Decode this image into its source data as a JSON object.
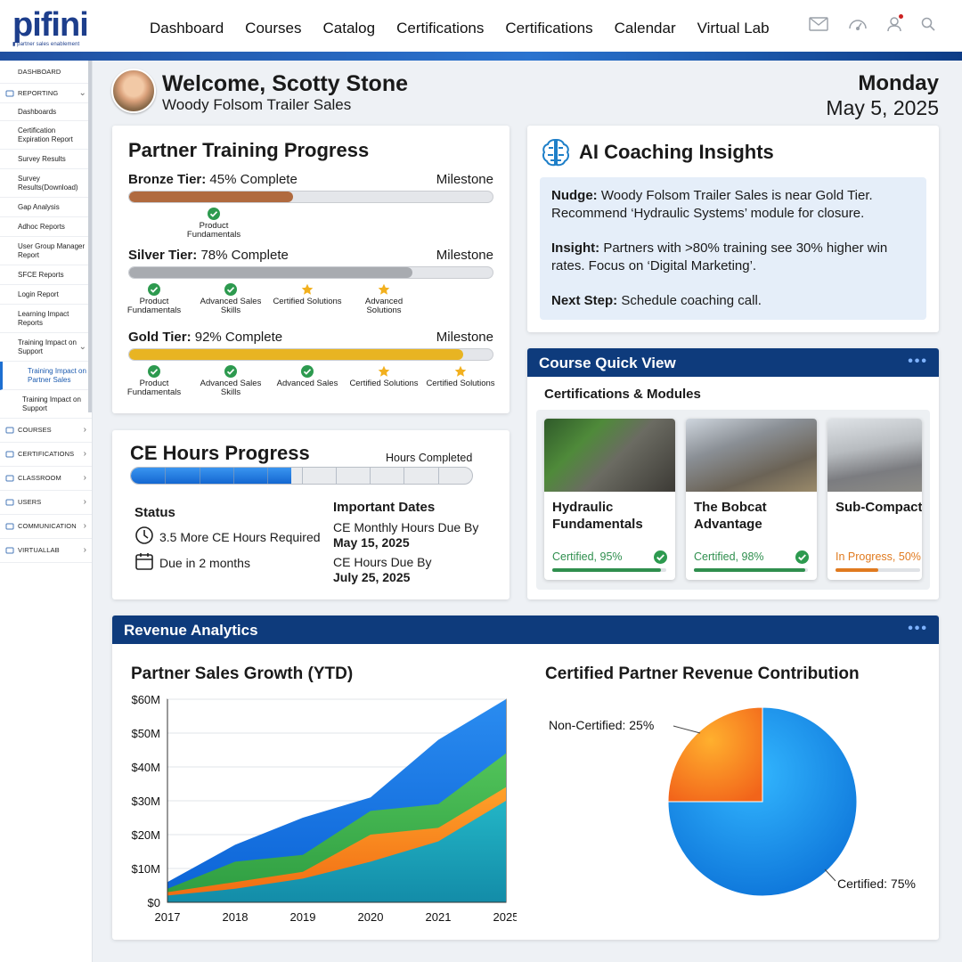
{
  "brand": {
    "name": "pifini",
    "tagline": "partner sales enablement"
  },
  "nav": [
    "Dashboard",
    "Courses",
    "Catalog",
    "Certifications",
    "Certifications",
    "Calendar",
    "Virtual Lab"
  ],
  "sidebar": {
    "items": [
      {
        "label": "DASHBOARD",
        "kind": "top"
      },
      {
        "label": "REPORTING",
        "kind": "head",
        "chev": "⌄"
      },
      {
        "label": "Dashboards",
        "kind": "sub"
      },
      {
        "label": "Certification Expiration Report",
        "kind": "sub"
      },
      {
        "label": "Survey Results",
        "kind": "sub"
      },
      {
        "label": "Survey Results(Download)",
        "kind": "sub"
      },
      {
        "label": "Gap Analysis",
        "kind": "sub"
      },
      {
        "label": "Adhoc Reports",
        "kind": "sub"
      },
      {
        "label": "User Group Manager Report",
        "kind": "sub"
      },
      {
        "label": "SFCE Reports",
        "kind": "sub"
      },
      {
        "label": "Login Report",
        "kind": "sub"
      },
      {
        "label": "Learning Impact Reports",
        "kind": "sub"
      },
      {
        "label": "Training Impact on Support",
        "kind": "sub",
        "chev": "⌄"
      },
      {
        "label": "Training Impact on Partner Sales",
        "kind": "sub2"
      },
      {
        "label": "Training Impact on Support",
        "kind": "sub3"
      },
      {
        "label": "COURSES",
        "kind": "head",
        "chev": "›"
      },
      {
        "label": "CERTIFICATIONS",
        "kind": "head",
        "chev": "›"
      },
      {
        "label": "CLASSROOM",
        "kind": "head",
        "chev": "›"
      },
      {
        "label": "USERS",
        "kind": "head",
        "chev": "›"
      },
      {
        "label": "COMMUNICATION",
        "kind": "head",
        "chev": "›"
      },
      {
        "label": "VIRTUALLAB",
        "kind": "head",
        "chev": "›"
      }
    ]
  },
  "welcome": {
    "greeting": "Welcome, Scotty Stone",
    "company": "Woody Folsom Trailer Sales"
  },
  "date": {
    "day": "Monday",
    "full": "May 5, 2025"
  },
  "training": {
    "title": "Partner Training Progress",
    "milestone_label": "Milestone",
    "tiers": [
      {
        "name": "Bronze Tier:",
        "status": "45% Complete",
        "progress": 0.45,
        "color": "#b06a3f",
        "milestones": [
          {
            "label": "Product Fundamentals",
            "icon": "check"
          }
        ]
      },
      {
        "name": "Silver Tier:",
        "status": "78% Complete",
        "progress": 0.78,
        "color": "#a8abb0",
        "milestones": [
          {
            "label": "Product Fundamentals",
            "icon": "check"
          },
          {
            "label": "Advanced Sales Skills",
            "icon": "check"
          },
          {
            "label": "Certified Solutions",
            "icon": "star"
          },
          {
            "label": "Advanced Solutions",
            "icon": "star"
          }
        ]
      },
      {
        "name": "Gold Tier:",
        "status": "92% Complete",
        "progress": 0.92,
        "color": "#e8b422",
        "milestones": [
          {
            "label": "Product Fundamentals",
            "icon": "check"
          },
          {
            "label": "Advanced Sales Skills",
            "icon": "check"
          },
          {
            "label": "Advanced Sales",
            "icon": "check"
          },
          {
            "label": "Certified Solutions",
            "icon": "star"
          },
          {
            "label": "Certified Solutions",
            "icon": "star"
          }
        ]
      }
    ]
  },
  "ai": {
    "title": "AI Coaching Insights",
    "nudge_label": "Nudge:",
    "nudge": "Woody Folsom Trailer Sales is near Gold Tier. Recommend ‘Hydraulic Systems’ module for closure.",
    "insight_label": "Insight:",
    "insight": "Partners with >80% training see 30% higher win rates. Focus on ‘Digital Marketing’.",
    "next_label": "Next Step:",
    "next": "Schedule coaching call."
  },
  "ce": {
    "title": "CE Hours Progress",
    "hours_label": "Hours Completed",
    "progress": 0.47,
    "status_label": "Status",
    "status_items": [
      {
        "icon": "clock-icon",
        "text": "3.5 More CE Hours Required"
      },
      {
        "icon": "calendar-icon",
        "text": "Due in 2 months"
      }
    ],
    "dates_label": "Important Dates",
    "dates": [
      {
        "label": "CE Monthly Hours Due By",
        "date": "May 15, 2025"
      },
      {
        "label": "CE Hours Due By",
        "date": "July 25, 2025"
      }
    ]
  },
  "course_view": {
    "title": "Course Quick View",
    "menu": "•••",
    "subtitle": "Certifications & Modules",
    "courses": [
      {
        "title": "Hydraulic Fundamentals",
        "status": "Certified, 95%",
        "progress": 0.95,
        "state": "certified",
        "color": "#2f8f4e"
      },
      {
        "title": "The Bobcat Advantage",
        "status": "Certified, 98%",
        "progress": 0.98,
        "state": "certified",
        "color": "#2f8f4e"
      },
      {
        "title": "Sub-Compact Utility Tractor",
        "status": "In Progress, 50%",
        "progress": 0.5,
        "state": "progress",
        "color": "#e07a1f"
      }
    ]
  },
  "revenue": {
    "title": "Revenue Analytics",
    "menu": "•••",
    "growth_title": "Partner Sales Growth (YTD)",
    "pie_title": "Certified Partner Revenue Contribution"
  },
  "chart_data": [
    {
      "type": "area",
      "title": "Partner Sales Growth (YTD)",
      "x": [
        "2017",
        "2018",
        "2019",
        "2020",
        "2021",
        "2025"
      ],
      "y_ticks": [
        "$0",
        "$10M",
        "$20M",
        "$30M",
        "$40M",
        "$50M",
        "$60M"
      ],
      "ylim": [
        0,
        60
      ],
      "series": [
        {
          "values": [
            6,
            17,
            25,
            31,
            48,
            60
          ],
          "color": "#1a73e8"
        },
        {
          "values": [
            4,
            12,
            14,
            27,
            29,
            44
          ],
          "color": "#3bb54a"
        },
        {
          "values": [
            3,
            6,
            9,
            20,
            22,
            34
          ],
          "color": "#f58a1f"
        },
        {
          "values": [
            2,
            4,
            7,
            12,
            18,
            30
          ],
          "color": "#1aa3b8"
        }
      ],
      "grid": true
    },
    {
      "type": "pie",
      "title": "Certified Partner Revenue Contribution",
      "slices": [
        {
          "label": "Certified: 75%",
          "value": 75,
          "color": "#1493e8"
        },
        {
          "label": "Non-Certified: 25%",
          "value": 25,
          "color": "#f7931e"
        }
      ]
    }
  ]
}
